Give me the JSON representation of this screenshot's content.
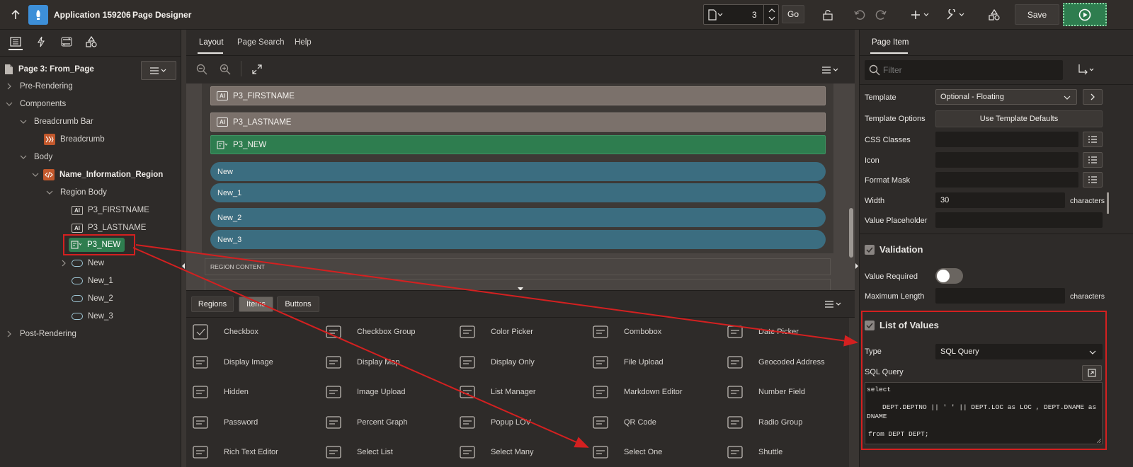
{
  "header": {
    "app_title": "Application 159206",
    "separator": "\\",
    "page_designer": "Page Designer",
    "page_number": "3",
    "go_label": "Go",
    "save_label": "Save"
  },
  "left": {
    "page_title": "Page 3: From_Page",
    "tree": {
      "pre_rendering": "Pre-Rendering",
      "components": "Components",
      "breadcrumb_bar": "Breadcrumb Bar",
      "breadcrumb": "Breadcrumb",
      "body": "Body",
      "region": "Name_Information_Region",
      "region_body": "Region Body",
      "firstname": "P3_FIRSTNAME",
      "lastname": "P3_LASTNAME",
      "p3_new": "P3_NEW",
      "new": "New",
      "new_1": "New_1",
      "new_2": "New_2",
      "new_3": "New_3",
      "post_rendering": "Post-Rendering"
    }
  },
  "center": {
    "tabs": [
      "Layout",
      "Page Search",
      "Help"
    ],
    "items": [
      "P3_FIRSTNAME",
      "P3_LASTNAME",
      "P3_NEW"
    ],
    "ai_badge": "AI",
    "buttons": [
      "New",
      "New_1",
      "New_2",
      "New_3"
    ],
    "region_content": "REGION CONTENT",
    "gallery_tabs": [
      "Regions",
      "Items",
      "Buttons"
    ],
    "gallery": [
      [
        "Checkbox",
        "Checkbox Group",
        "Color Picker",
        "Combobox",
        "Date Picker"
      ],
      [
        "Display Image",
        "Display Map",
        "Display Only",
        "File Upload",
        "Geocoded Address"
      ],
      [
        "Hidden",
        "Image Upload",
        "List Manager",
        "Markdown Editor",
        "Number Field"
      ],
      [
        "Password",
        "Percent Graph",
        "Popup LOV",
        "QR Code",
        "Radio Group"
      ],
      [
        "Rich Text Editor",
        "Select List",
        "Select Many",
        "Select One",
        "Shuttle"
      ]
    ]
  },
  "right": {
    "tab": "Page Item",
    "filter_placeholder": "Filter",
    "template_label": "Template",
    "template_value": "Optional - Floating",
    "template_options_label": "Template Options",
    "template_options_btn": "Use Template Defaults",
    "css_classes_label": "CSS Classes",
    "icon_label": "Icon",
    "format_mask_label": "Format Mask",
    "width_label": "Width",
    "width_value": "30",
    "characters": "characters",
    "value_placeholder_label": "Value Placeholder",
    "validation_head": "Validation",
    "value_required_label": "Value Required",
    "max_length_label": "Maximum Length",
    "lov_head": "List of Values",
    "type_label": "Type",
    "type_value": "SQL Query",
    "sql_query_label": "SQL Query",
    "sql_line1": "select",
    "sql_line2": "DEPT.DEPTNO || ' ' || DEPT.LOC as LOC   , DEPT.DNAME as",
    "sql_line3": "DNAME",
    "sql_line4": "from DEPT DEPT;"
  },
  "colors": {
    "accent_green": "#2e7d4f",
    "button_teal": "#3b6d80",
    "annotation_red": "#d42020"
  }
}
